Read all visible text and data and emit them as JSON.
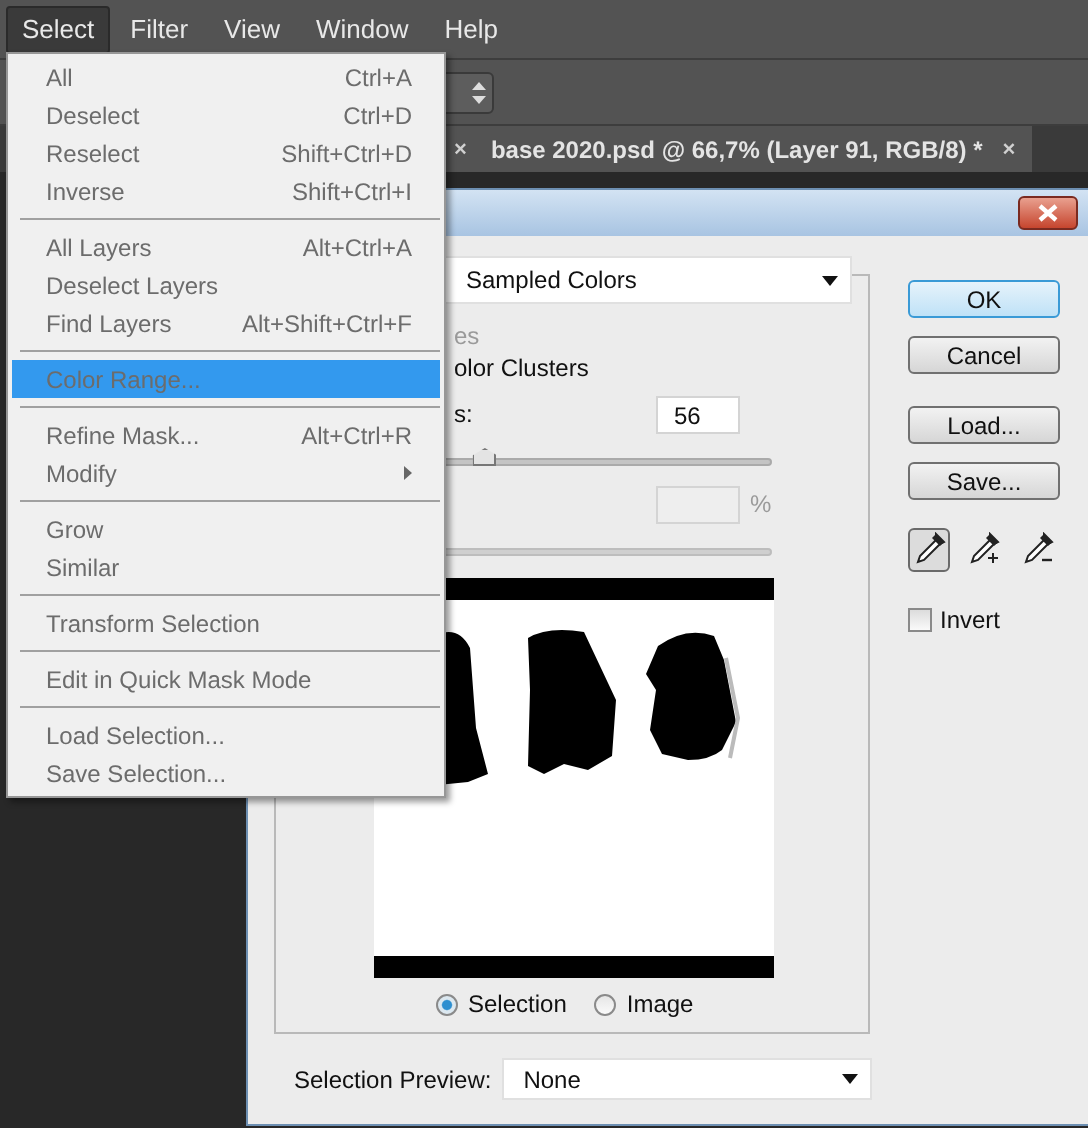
{
  "menubar": [
    {
      "label": "Select",
      "selected": true
    },
    {
      "label": "Filter",
      "selected": false
    },
    {
      "label": "View",
      "selected": false
    },
    {
      "label": "Window",
      "selected": false
    },
    {
      "label": "Help",
      "selected": false
    }
  ],
  "tabs": [
    {
      "close": "×"
    },
    {
      "label": "base 2020.psd @ 66,7% (Layer 91, RGB/8) *",
      "close": "×"
    }
  ],
  "menu": {
    "groups": [
      [
        {
          "label": "All",
          "shortcut": "Ctrl+A",
          "selected": false,
          "submenu": false
        },
        {
          "label": "Deselect",
          "shortcut": "Ctrl+D",
          "selected": false,
          "submenu": false
        },
        {
          "label": "Reselect",
          "shortcut": "Shift+Ctrl+D",
          "selected": false,
          "submenu": false
        },
        {
          "label": "Inverse",
          "shortcut": "Shift+Ctrl+I",
          "selected": false,
          "submenu": false
        }
      ],
      [
        {
          "label": "All Layers",
          "shortcut": "Alt+Ctrl+A",
          "selected": false,
          "submenu": false
        },
        {
          "label": "Deselect Layers",
          "selected": false,
          "submenu": false
        },
        {
          "label": "Find Layers",
          "shortcut": "Alt+Shift+Ctrl+F",
          "selected": false,
          "submenu": false
        }
      ],
      [
        {
          "label": "Color Range...",
          "selected": true,
          "submenu": false
        }
      ],
      [
        {
          "label": "Refine Mask...",
          "shortcut": "Alt+Ctrl+R",
          "selected": false,
          "submenu": false
        },
        {
          "label": "Modify",
          "selected": false,
          "submenu": true
        }
      ],
      [
        {
          "label": "Grow",
          "selected": false,
          "submenu": false
        },
        {
          "label": "Similar",
          "selected": false,
          "submenu": false
        }
      ],
      [
        {
          "label": "Transform Selection",
          "selected": false,
          "submenu": false
        }
      ],
      [
        {
          "label": "Edit in Quick Mask Mode",
          "selected": false,
          "submenu": false
        }
      ],
      [
        {
          "label": "Load Selection...",
          "selected": false,
          "submenu": false
        },
        {
          "label": "Save Selection...",
          "selected": false,
          "submenu": false
        }
      ]
    ]
  },
  "dialog": {
    "method": {
      "value": "Sampled Colors"
    },
    "rows": [
      {
        "kind": "text",
        "label": "es",
        "disabled": true
      },
      {
        "kind": "text",
        "label": "olor Clusters",
        "disabled": false
      },
      {
        "kind": "field",
        "label": "s:",
        "value": "56",
        "disabled": false
      },
      {
        "kind": "slider",
        "level": 0.28,
        "disabled": false
      },
      {
        "kind": "field",
        "unit": "%",
        "disabled": true
      },
      {
        "kind": "slider",
        "disabled": true
      }
    ],
    "radios": [
      {
        "label": "Selection",
        "selected": true
      },
      {
        "label": "Image",
        "selected": false
      }
    ],
    "selection_preview": {
      "label": "Selection Preview:",
      "value": "None"
    },
    "buttons": [
      {
        "label": "OK",
        "default": true
      },
      {
        "label": "Cancel",
        "default": false
      },
      {
        "label": "Load...",
        "default": false
      },
      {
        "label": "Save...",
        "default": false
      }
    ],
    "samplers": [
      {
        "kind": "plain",
        "selected": true
      },
      {
        "kind": "add",
        "selected": false
      },
      {
        "kind": "subtract",
        "selected": false
      }
    ],
    "invert": {
      "label": "Invert",
      "checked": false
    }
  }
}
